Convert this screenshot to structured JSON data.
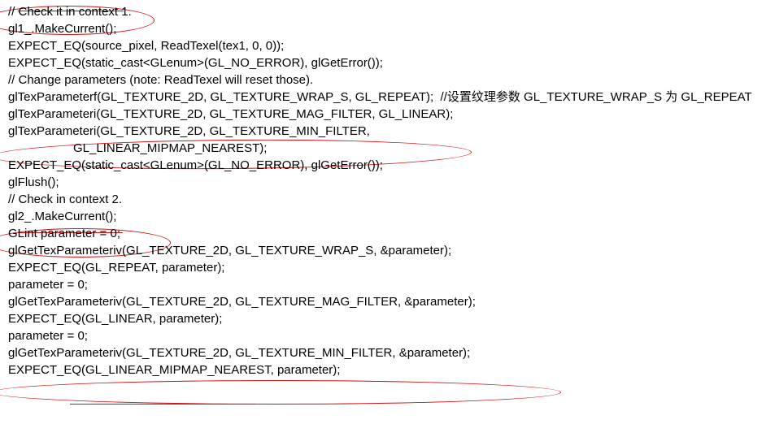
{
  "code": {
    "l1": "// Check it in context 1.",
    "l2": "gl1_.MakeCurrent();",
    "l3": "EXPECT_EQ(source_pixel, ReadTexel(tex1, 0, 0));",
    "l4": "EXPECT_EQ(static_cast<GLenum>(GL_NO_ERROR), glGetError());",
    "l5": "",
    "l6": "// Change parameters (note: ReadTexel will reset those).",
    "l7": "glTexParameterf(GL_TEXTURE_2D, GL_TEXTURE_WRAP_S, GL_REPEAT);  //设置纹理参数 GL_TEXTURE_WRAP_S 为 GL_REPEAT",
    "l8": "glTexParameteri(GL_TEXTURE_2D, GL_TEXTURE_MAG_FILTER, GL_LINEAR);",
    "l9": "glTexParameteri(GL_TEXTURE_2D, GL_TEXTURE_MIN_FILTER,",
    "l10": "GL_LINEAR_MIPMAP_NEAREST);",
    "l11": "EXPECT_EQ(static_cast<GLenum>(GL_NO_ERROR), glGetError());",
    "l12": "glFlush();",
    "l13": "",
    "l14": "// Check in context 2.",
    "l15": "gl2_.MakeCurrent();",
    "l16": "GLint parameter = 0;",
    "l17": "glGetTexParameteriv(GL_TEXTURE_2D, GL_TEXTURE_WRAP_S, &parameter);",
    "l18": "EXPECT_EQ(GL_REPEAT, parameter);",
    "l19": "parameter = 0;",
    "l20": "glGetTexParameteriv(GL_TEXTURE_2D, GL_TEXTURE_MAG_FILTER, &parameter);",
    "l21": "EXPECT_EQ(GL_LINEAR, parameter);",
    "l22": "parameter = 0;",
    "l23": "glGetTexParameteriv(GL_TEXTURE_2D, GL_TEXTURE_MIN_FILTER, &parameter);",
    "l24": "EXPECT_EQ(GL_LINEAR_MIPMAP_NEAREST, parameter);"
  }
}
